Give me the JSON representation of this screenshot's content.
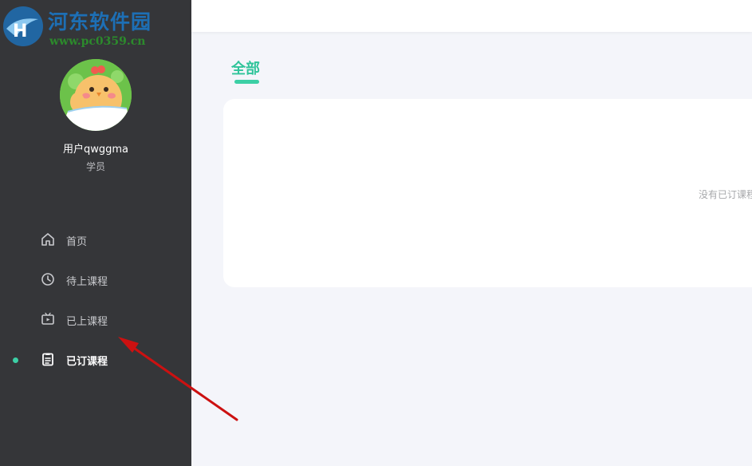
{
  "watermark": {
    "title": "河东软件园",
    "url": "www.pc0359.cn"
  },
  "user": {
    "name": "用户qwggma",
    "role": "学员",
    "avatar_icon": "chick-avatar-icon"
  },
  "sidebar": {
    "items": [
      {
        "label": "首页",
        "icon": "home-icon",
        "active": false
      },
      {
        "label": "待上课程",
        "icon": "clock-icon",
        "active": false
      },
      {
        "label": "已上课程",
        "icon": "tv-play-icon",
        "active": false
      },
      {
        "label": "已订课程",
        "icon": "clipboard-icon",
        "active": true
      }
    ]
  },
  "main": {
    "tab_label": "全部",
    "empty_message": "没有已订课程"
  },
  "colors": {
    "sidebar_bg": "#353639",
    "accent": "#3ccfa5",
    "page_bg": "#f4f5fa",
    "annotation_arrow": "#cc1111"
  }
}
